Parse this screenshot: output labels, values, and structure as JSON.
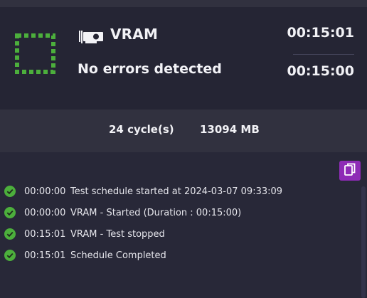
{
  "header": {
    "test_icon": "gpu-card-icon",
    "status_icon": "dashed-green-square-icon",
    "test_name": "VRAM",
    "result": "No errors detected",
    "time_elapsed": "00:15:01",
    "time_duration": "00:15:00"
  },
  "stats": {
    "cycles": "24 cycle(s)",
    "memory": "13094 MB"
  },
  "log": {
    "copy_icon": "copy-icon",
    "entries": [
      {
        "time": "00:00:00",
        "message": "Test schedule started at 2024-03-07 09:33:09",
        "icon": "check-circle-icon"
      },
      {
        "time": "00:00:00",
        "message": "VRAM - Started (Duration : 00:15:00)",
        "icon": "check-circle-icon"
      },
      {
        "time": "00:15:01",
        "message": "VRAM - Test stopped",
        "icon": "check-circle-icon"
      },
      {
        "time": "00:15:01",
        "message": "Schedule Completed",
        "icon": "check-circle-icon"
      }
    ]
  },
  "colors": {
    "success_green": "#4caf3c",
    "accent_purple": "#8e2bb6",
    "panel_dark": "#252534",
    "panel_light": "#31313f",
    "background": "#282838"
  }
}
